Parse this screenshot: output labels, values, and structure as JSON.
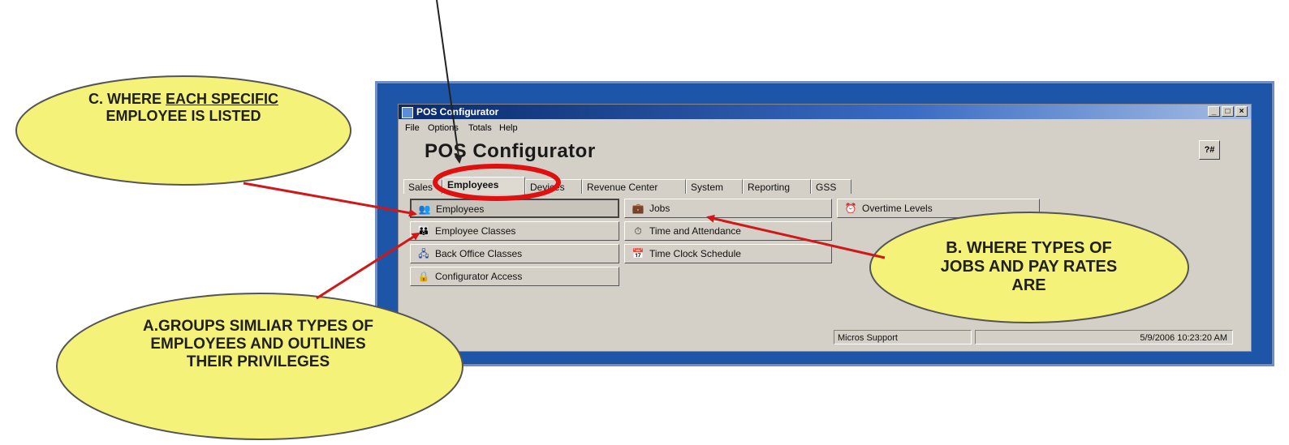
{
  "window": {
    "title": "POS Configurator",
    "app_heading": "POS Configurator",
    "menu": [
      "File",
      "Options",
      "Totals",
      "Help"
    ],
    "window_controls": [
      "_",
      "□",
      "×"
    ],
    "help_button_label": "?#",
    "tabs": [
      "Sales",
      "Employees",
      "Devices",
      "Revenue Center",
      "System",
      "Reporting",
      "GSS"
    ],
    "active_tab": "Employees",
    "columns": [
      {
        "items": [
          {
            "label": "Employees",
            "icon": "employees-icon",
            "glyph": "👥",
            "selected": true
          },
          {
            "label": "Employee Classes",
            "icon": "employee-classes-icon",
            "glyph": "👪"
          },
          {
            "label": "Back Office Classes",
            "icon": "back-office-classes-icon",
            "glyph": "🖧"
          },
          {
            "label": "Configurator Access",
            "icon": "lock-icon",
            "glyph": "🔒"
          }
        ]
      },
      {
        "items": [
          {
            "label": "Jobs",
            "icon": "jobs-icon",
            "glyph": "💼"
          },
          {
            "label": "Time and Attendance",
            "icon": "time-attendance-icon",
            "glyph": "⏱"
          },
          {
            "label": "Time Clock Schedule",
            "icon": "time-clock-schedule-icon",
            "glyph": "📅"
          }
        ]
      },
      {
        "items": [
          {
            "label": "Overtime Levels",
            "icon": "overtime-levels-icon",
            "glyph": "⏰"
          }
        ]
      }
    ],
    "status": {
      "user": "Micros Support",
      "datetime": "5/9/2006 10:23:20 AM"
    }
  },
  "callouts": {
    "c": {
      "title_plain": "C. WHERE ",
      "title_underlined": "EACH SPECIFIC",
      "rest": "EMPLOYEE IS LISTED"
    },
    "a": {
      "text": "A.GROUPS SIMLIAR TYPES OF EMPLOYEES AND OUTLINES THEIR PRIVILEGES"
    },
    "b": {
      "text": "B. WHERE TYPES OF JOBS AND PAY RATES ARE"
    }
  },
  "colors": {
    "callout_fill": "#f5f27a",
    "arrow": "#d01818",
    "highlight_ring": "#e01010",
    "frame": "#1d55a8"
  }
}
